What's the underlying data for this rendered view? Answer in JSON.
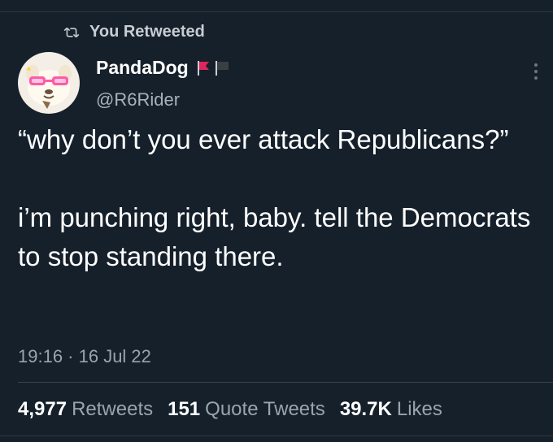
{
  "retweet": {
    "label": "You Retweeted",
    "icon": "retweet-icon"
  },
  "author": {
    "display_name": "PandaDog",
    "handle": "@R6Rider",
    "avatar_icon": "panda-dog-with-sunglasses",
    "flag_icons": [
      "red-flag-icon",
      "black-flag-icon"
    ],
    "flag_colors": [
      "#e0245e",
      "#3a3f44"
    ]
  },
  "tweet": {
    "paragraphs": [
      "“why don’t you ever attack Republicans?”",
      "i’m punching right, baby. tell the Democrats to stop standing there."
    ],
    "timestamp": "19:16 · 16 Jul 22"
  },
  "stats": [
    {
      "value": "4,977",
      "label": "Retweets"
    },
    {
      "value": "151",
      "label": "Quote Tweets"
    },
    {
      "value": "39.7K",
      "label": "Likes"
    }
  ],
  "colors": {
    "background": "#15202b",
    "text": "#ffffff",
    "muted": "#9aa4ad"
  }
}
